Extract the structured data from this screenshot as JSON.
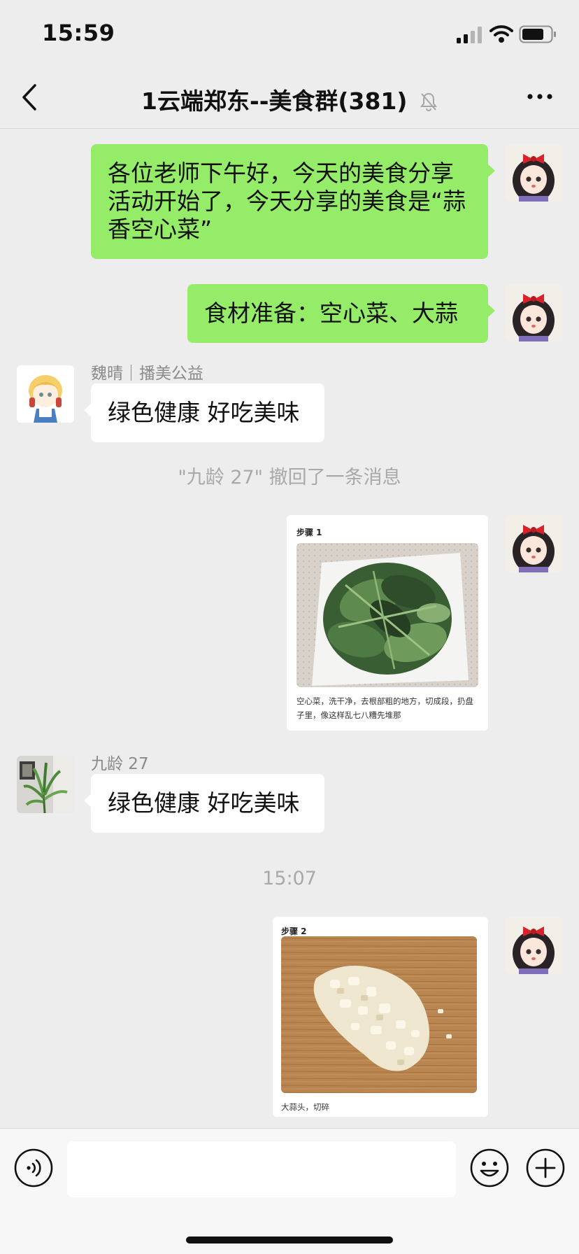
{
  "status_bar": {
    "time": "15:59",
    "icons": [
      "signal-icon",
      "wifi-icon",
      "battery-icon"
    ]
  },
  "nav": {
    "title": "1云端郑东--美食群(381)",
    "icons": [
      "back-icon",
      "mute-icon",
      "more-icon"
    ]
  },
  "messages": [
    {
      "kind": "text",
      "side": "right",
      "text": "各位老师下午好，今天的美食分享活动开始了，今天分享的美食是“蒜香空心菜”"
    },
    {
      "kind": "text",
      "side": "right",
      "text": "食材准备：空心菜、大蒜"
    },
    {
      "kind": "text",
      "side": "left",
      "sender": "魏晴｜播美公益",
      "text": "绿色健康 好吃美味"
    },
    {
      "kind": "system",
      "text": "\"九龄 27\" 撤回了一条消息"
    },
    {
      "kind": "card",
      "side": "right",
      "step": "步骤 1",
      "caption": "空心菜，洗干净，去根部粗的地方，切成段，扔盘子里，像这样乱七八糟先堆那"
    },
    {
      "kind": "text",
      "side": "left",
      "sender": "九龄 27",
      "text": "绿色健康 好吃美味"
    },
    {
      "kind": "time",
      "text": "15:07"
    },
    {
      "kind": "card",
      "side": "right",
      "step": "步骤 2",
      "caption": "大蒜头，切碎"
    }
  ],
  "input_bar": {
    "placeholder": "",
    "icons": [
      "voice-icon",
      "emoji-icon",
      "plus-icon"
    ]
  },
  "colors": {
    "background": "#ededed",
    "bubble_self": "#95ec69",
    "bubble_other": "#ffffff"
  }
}
